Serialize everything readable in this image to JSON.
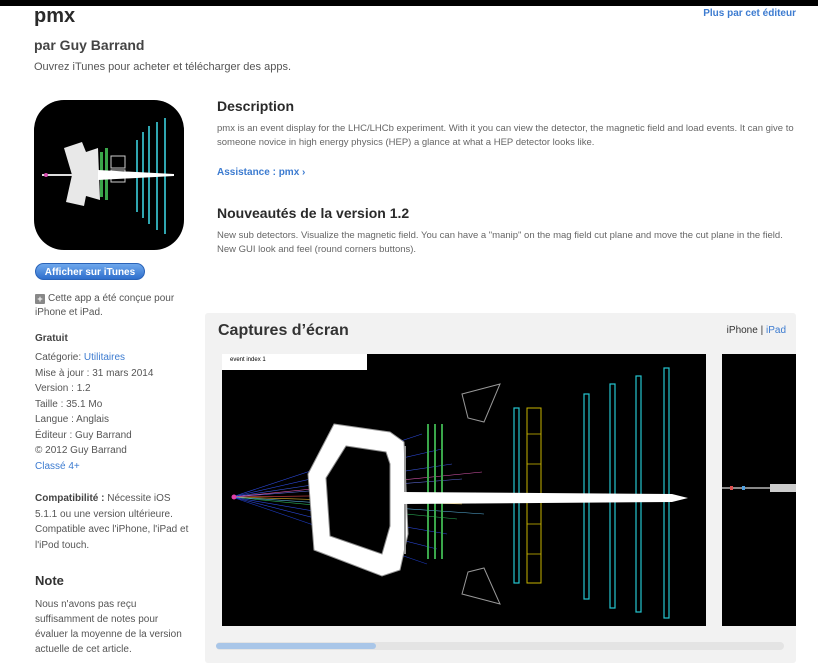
{
  "header": {
    "title": "pmx",
    "more_link": "Plus par cet éditeur",
    "byline": "par Guy Barrand",
    "tagline": "Ouvrez iTunes pour acheter et télécharger des apps."
  },
  "sidebar": {
    "itunes_button": "Afficher sur iTunes",
    "designed_for": "Cette app a été conçue pour iPhone et iPad.",
    "price": "Gratuit",
    "category_label": "Catégorie:",
    "category_value": "Utilitaires",
    "updated": "Mise à jour : 31 mars 2014",
    "version": "Version : 1.2",
    "size": "Taille : 35.1 Mo",
    "language": "Langue : Anglais",
    "developer": "Éditeur : Guy Barrand",
    "copyright": "© 2012 Guy Barrand",
    "rating": "Classé 4+",
    "compat_label": "Compatibilité :",
    "compat_text": "Nécessite iOS 5.1.1 ou une version ultérieure. Compatible avec l'iPhone, l'iPad et l'iPod touch.",
    "note_heading": "Note",
    "note_text": "Nous n'avons pas reçu suffisamment de notes pour évaluer la moyenne de la version actuelle de cet article."
  },
  "main": {
    "description_heading": "Description",
    "description_text": "pmx is an event display for the LHC/LHCb experiment. With it you can view the detector, the magnetic field and load events. It can give to someone novice in high energy physics (HEP) a glance at what a HEP detector looks like.",
    "support_link": "Assistance : pmx ›",
    "whatsnew_heading": "Nouveautés de la version 1.2",
    "whatsnew_text": "New sub detectors. Visualize the magnetic field. You can have a \"manip\" on the mag field cut plane and move the cut plane in the field. New GUI look and feel (round corners buttons)."
  },
  "screenshots": {
    "heading": "Captures d’écran",
    "device_iphone": "iPhone",
    "separator": "|",
    "device_ipad": "iPad",
    "event_label": "event index 1"
  },
  "icons": {
    "app_icon": "pmx-detector-icon",
    "plus_icon": "plus-box-icon"
  },
  "colors": {
    "link": "#3c7bd0",
    "button": "#2f6fcd"
  }
}
